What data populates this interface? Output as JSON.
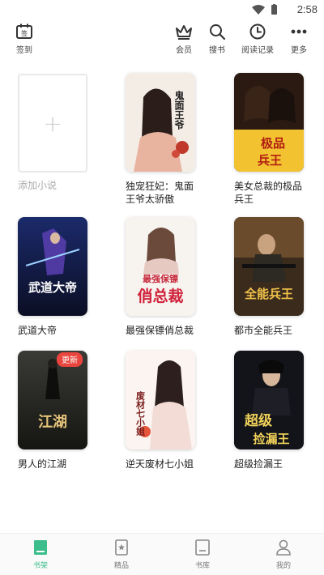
{
  "status": {
    "time": "2:58"
  },
  "toolbar": {
    "signin": "签到",
    "member": "会员",
    "search": "搜书",
    "history": "阅读记录",
    "more": "更多"
  },
  "add_card": {
    "label": "添加小说"
  },
  "books": [
    {
      "title": "独宠狂妃：鬼面王爷太骄傲"
    },
    {
      "title": "美女总裁的极品兵王"
    },
    {
      "title": "武道大帝"
    },
    {
      "title": "最强保镖俏总裁"
    },
    {
      "title": "都市全能兵王"
    },
    {
      "title": "男人的江湖",
      "badge": "更新"
    },
    {
      "title": "逆天废材七小姐"
    },
    {
      "title": "超级捡漏王"
    }
  ],
  "covers": {
    "c1": "鬼面王爷",
    "c2a": "极品",
    "c2b": "兵王",
    "c3": "武道大帝",
    "c4a": "最强保镖",
    "c4b": "俏总裁",
    "c5": "全能兵王",
    "c6": "江湖",
    "c7": "废材七小姐",
    "c8a": "超级",
    "c8b": "捡漏王"
  },
  "bottom_nav": {
    "shelf": "书架",
    "featured": "精品",
    "library": "书库",
    "mine": "我的"
  },
  "colors": {
    "accent": "#3cbd8c",
    "badge": "#e9453e"
  }
}
